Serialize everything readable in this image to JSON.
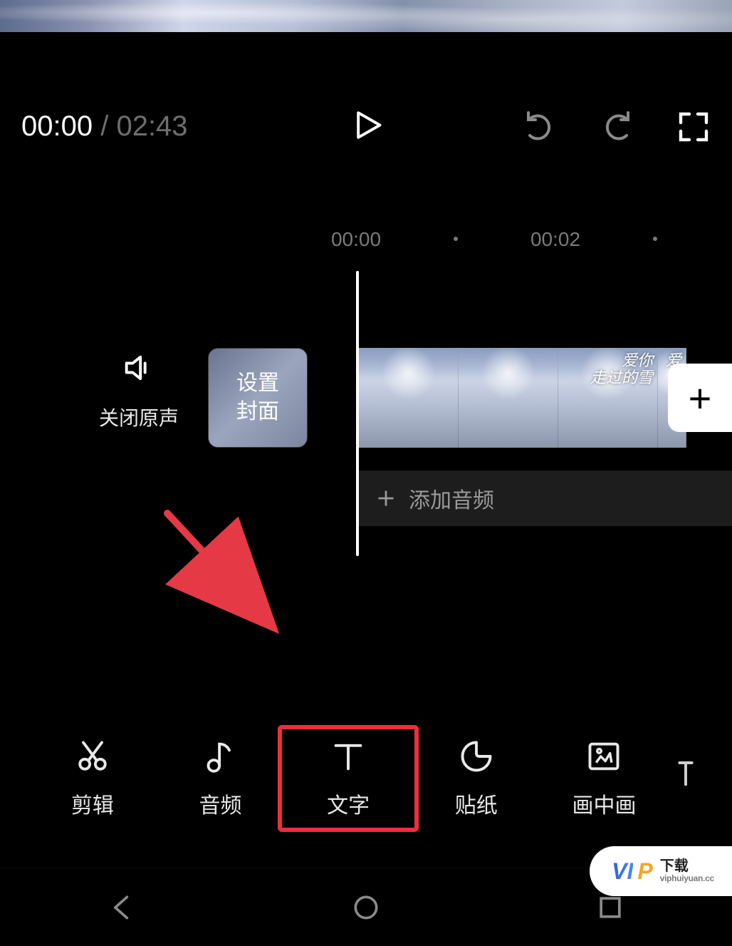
{
  "player": {
    "current_time": "00:00",
    "separator": " / ",
    "duration": "02:43"
  },
  "ruler": {
    "marks": [
      "00:00",
      "00:02"
    ]
  },
  "timeline": {
    "mute_label": "关闭原声",
    "cover_btn": "设置\n封面",
    "add_audio": "添加音频",
    "clip_overlay_1": "爱你",
    "clip_overlay_2": "走过的雪",
    "clip_overlay_3": "爱"
  },
  "toolbar": {
    "items": [
      {
        "label": "剪辑",
        "icon": "scissors-icon"
      },
      {
        "label": "音频",
        "icon": "music-note-icon"
      },
      {
        "label": "文字",
        "icon": "text-icon"
      },
      {
        "label": "贴纸",
        "icon": "sticker-icon"
      },
      {
        "label": "画中画",
        "icon": "pip-icon"
      }
    ],
    "highlight_index": 2
  },
  "watermark": {
    "title": "下载",
    "url": "viphuiyuan.cc"
  },
  "colors": {
    "highlight": "#f02d3a",
    "arrow": "#e53946"
  }
}
